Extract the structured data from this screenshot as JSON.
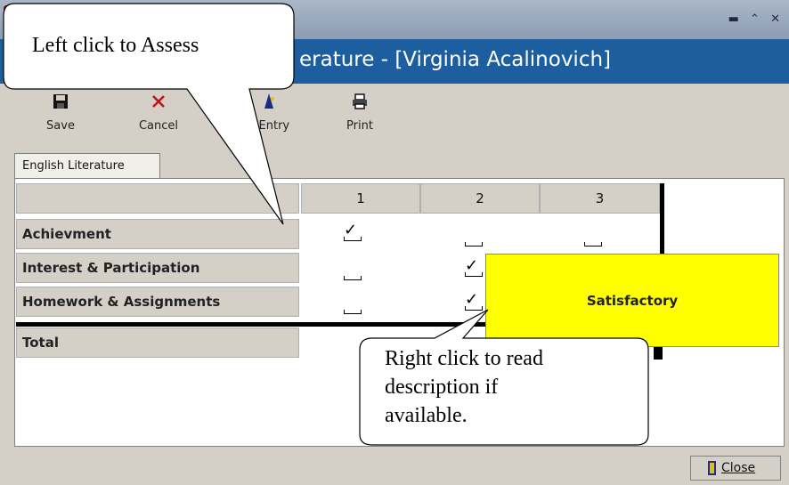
{
  "window": {
    "title_bar_text": ""
  },
  "form": {
    "title": "erature - [Virginia Acalinovich]"
  },
  "toolbar": {
    "save": "Save",
    "cancel": "Cancel",
    "quick_entry": "k Entry",
    "print": "Print"
  },
  "tab": {
    "label": "English Literature"
  },
  "grid": {
    "columns": [
      "1",
      "2",
      "3"
    ],
    "rows": [
      {
        "label": "Achievment",
        "marks": [
          "tick",
          "blank",
          "blank"
        ]
      },
      {
        "label": "Interest & Participation",
        "marks": [
          "blank",
          "tick",
          ""
        ]
      },
      {
        "label": "Homework & Assignments",
        "marks": [
          "blank",
          "tick",
          ""
        ]
      }
    ],
    "total_label": "Total"
  },
  "popup": {
    "text": "Satisfactory",
    "color": "#ffff00"
  },
  "callouts": {
    "left_click": "Left click to Assess",
    "right_click_lines": [
      "Right click to read",
      "description if",
      "available."
    ]
  },
  "footer": {
    "close_label": "Close"
  },
  "colors": {
    "title_bar": "#1c5e9e",
    "chrome": "#d4d0c8"
  }
}
